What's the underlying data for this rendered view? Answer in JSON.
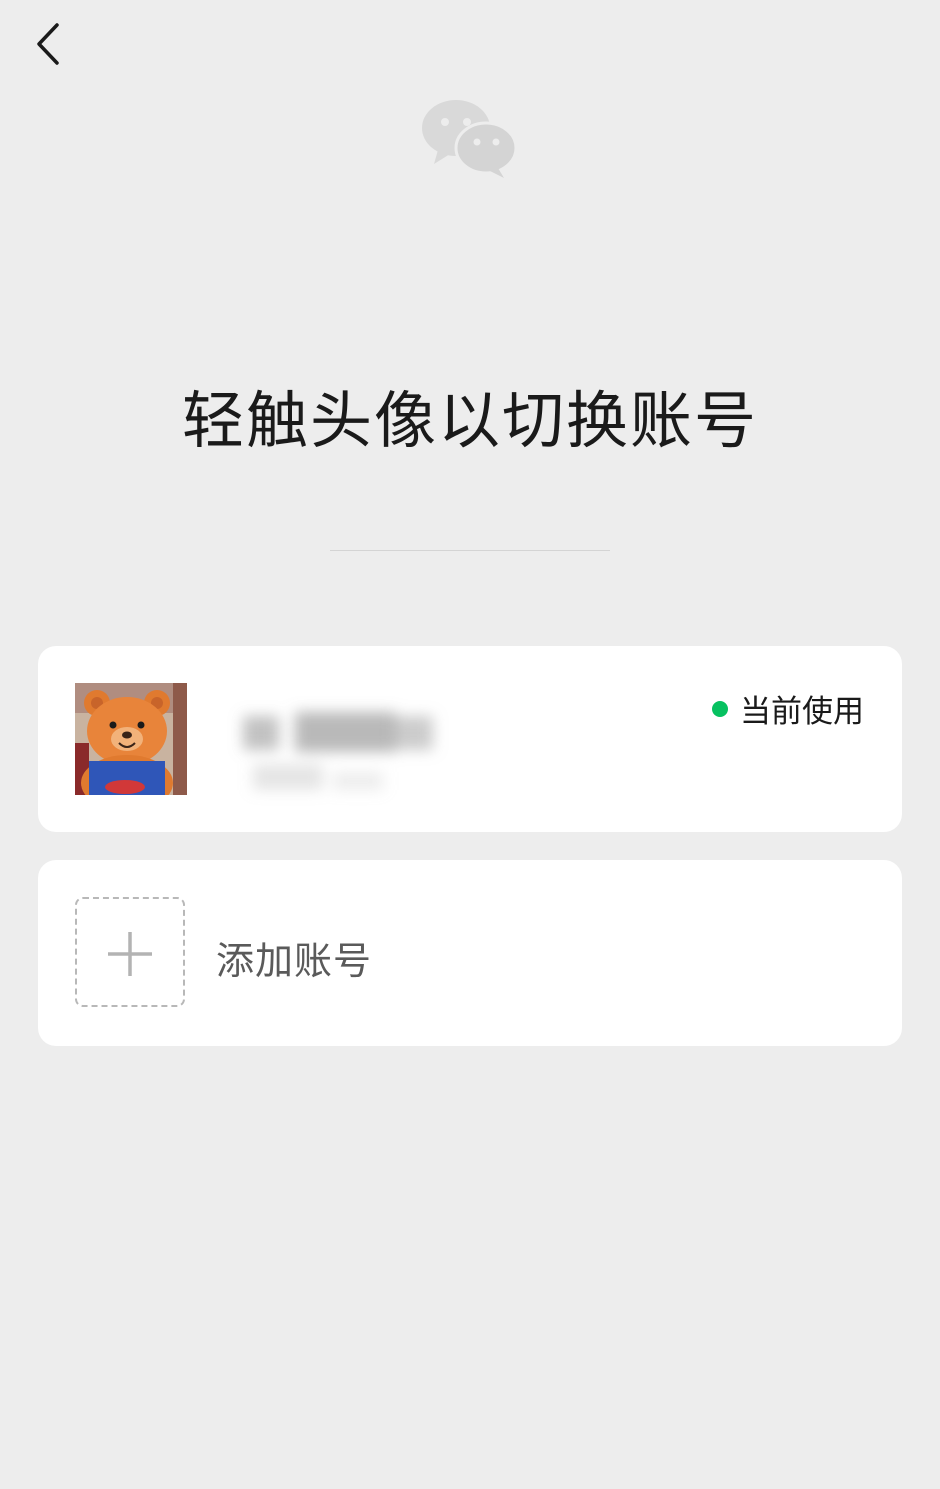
{
  "header": {
    "back_icon": "chevron-left-icon",
    "logo_icon": "wechat-logo-icon"
  },
  "main": {
    "title": "轻触头像以切换账号"
  },
  "accounts": {
    "current": {
      "avatar_icon": "bear-avatar",
      "status_label": "当前使用",
      "status_color": "#07c160"
    },
    "add": {
      "icon": "plus-icon",
      "label": "添加账号"
    }
  }
}
